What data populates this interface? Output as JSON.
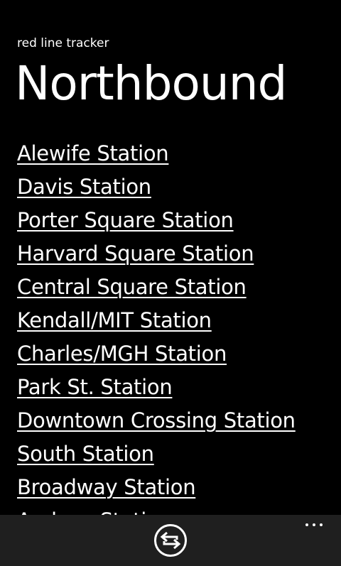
{
  "header": {
    "app_title": "red line tracker",
    "page_title": "Northbound"
  },
  "stations": [
    {
      "label": "Alewife Station"
    },
    {
      "label": "Davis Station"
    },
    {
      "label": "Porter Square Station"
    },
    {
      "label": "Harvard Square Station"
    },
    {
      "label": "Central Square Station"
    },
    {
      "label": "Kendall/MIT Station"
    },
    {
      "label": "Charles/MGH Station"
    },
    {
      "label": "Park St. Station"
    },
    {
      "label": "Downtown Crossing Station"
    },
    {
      "label": "South Station"
    },
    {
      "label": "Broadway Station"
    },
    {
      "label": "Andrew Station"
    }
  ],
  "app_bar": {
    "switch_direction_icon": "switch-direction-icon",
    "more_icon": "more-ellipsis-icon"
  },
  "colors": {
    "background": "#000000",
    "text": "#ffffff",
    "app_bar": "#1f1f1f"
  }
}
